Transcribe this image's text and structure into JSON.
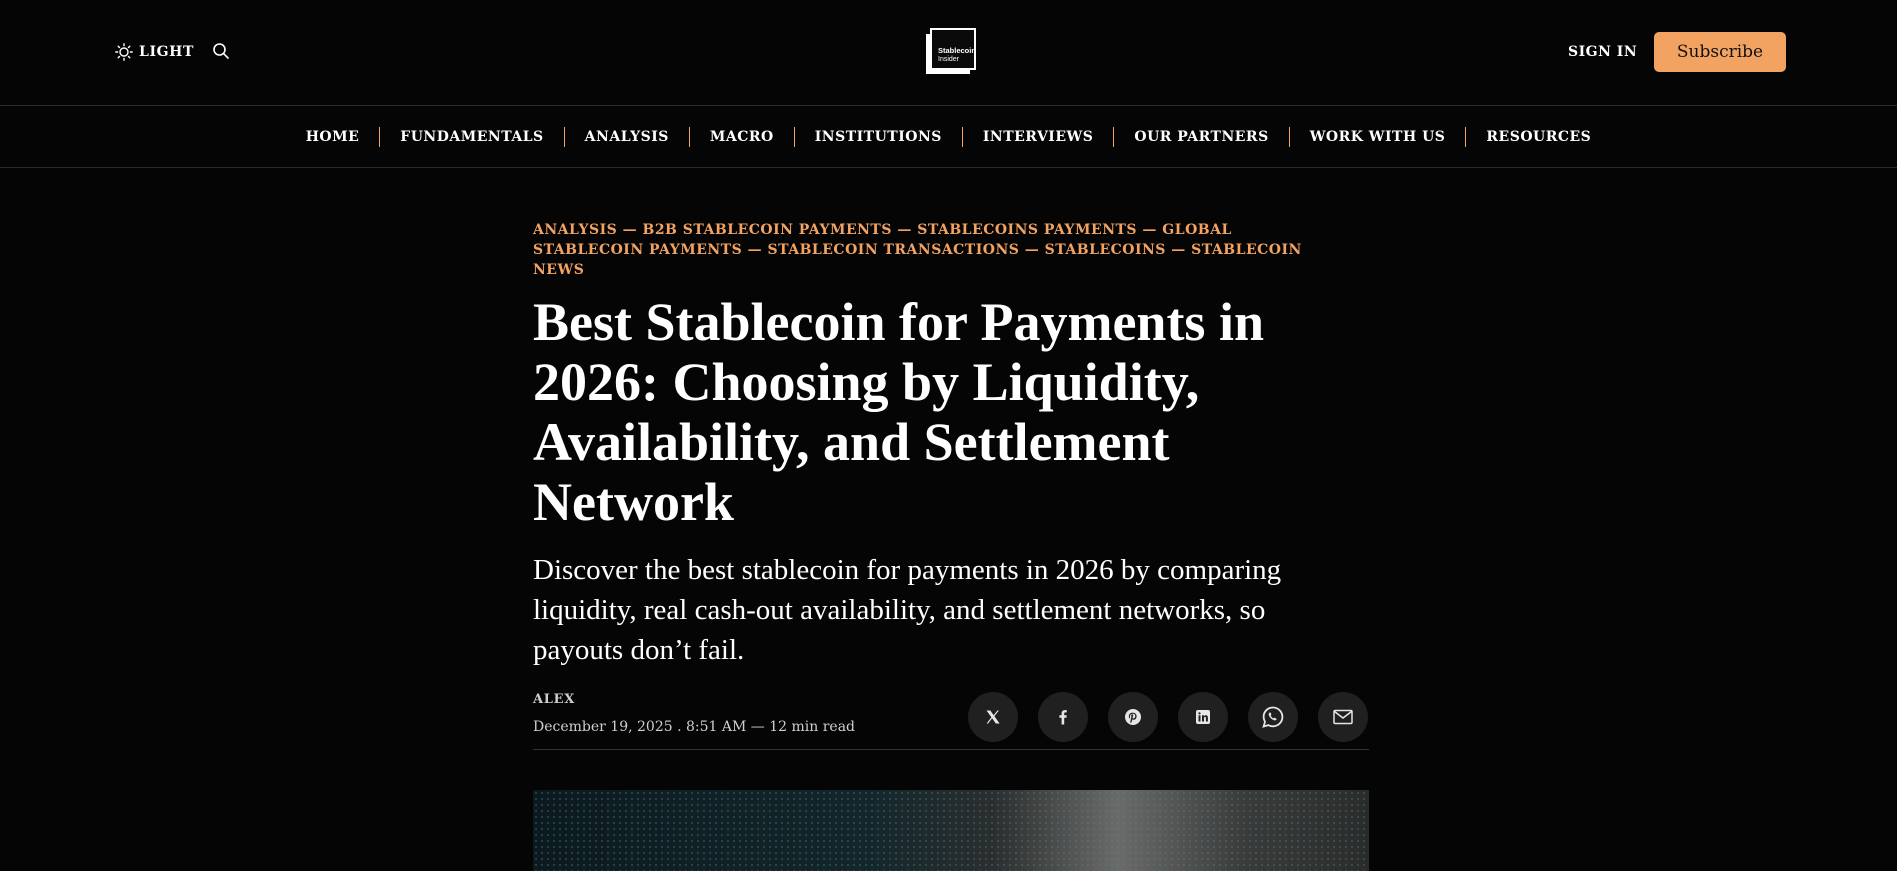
{
  "header": {
    "theme_label": "LIGHT",
    "logo_text_line1": "Stablecoin",
    "logo_text_line2": "Insider",
    "signin_label": "SIGN IN",
    "subscribe_label": "Subscribe",
    "accent_color": "#f2a361"
  },
  "nav": {
    "items": [
      {
        "label": "HOME"
      },
      {
        "label": "FUNDAMENTALS"
      },
      {
        "label": "ANALYSIS"
      },
      {
        "label": "MACRO"
      },
      {
        "label": "INSTITUTIONS"
      },
      {
        "label": "INTERVIEWS"
      },
      {
        "label": "OUR PARTNERS"
      },
      {
        "label": "WORK WITH US"
      },
      {
        "label": "RESOURCES"
      }
    ]
  },
  "article": {
    "tags": [
      "ANALYSIS",
      "B2B STABLECOIN PAYMENTS",
      "STABLECOINS PAYMENTS",
      "GLOBAL STABLECOIN PAYMENTS",
      "STABLECOIN TRANSACTIONS",
      "STABLECOINS",
      "STABLECOIN NEWS"
    ],
    "tag_separator": "—",
    "title": "Best Stablecoin for Payments in 2026: Choosing by Liquidity, Availability, and Settlement Network",
    "dek": "Discover the best stablecoin for payments in 2026 by comparing liquidity, real cash-out availability, and settlement networks, so payouts don’t fail.",
    "author": "ALEX",
    "dateline": "December 19, 2025 . 8:51 AM — 12 min read",
    "share_icons": [
      "x-icon",
      "facebook-icon",
      "pinterest-icon",
      "linkedin-icon",
      "whatsapp-icon",
      "email-icon"
    ]
  }
}
